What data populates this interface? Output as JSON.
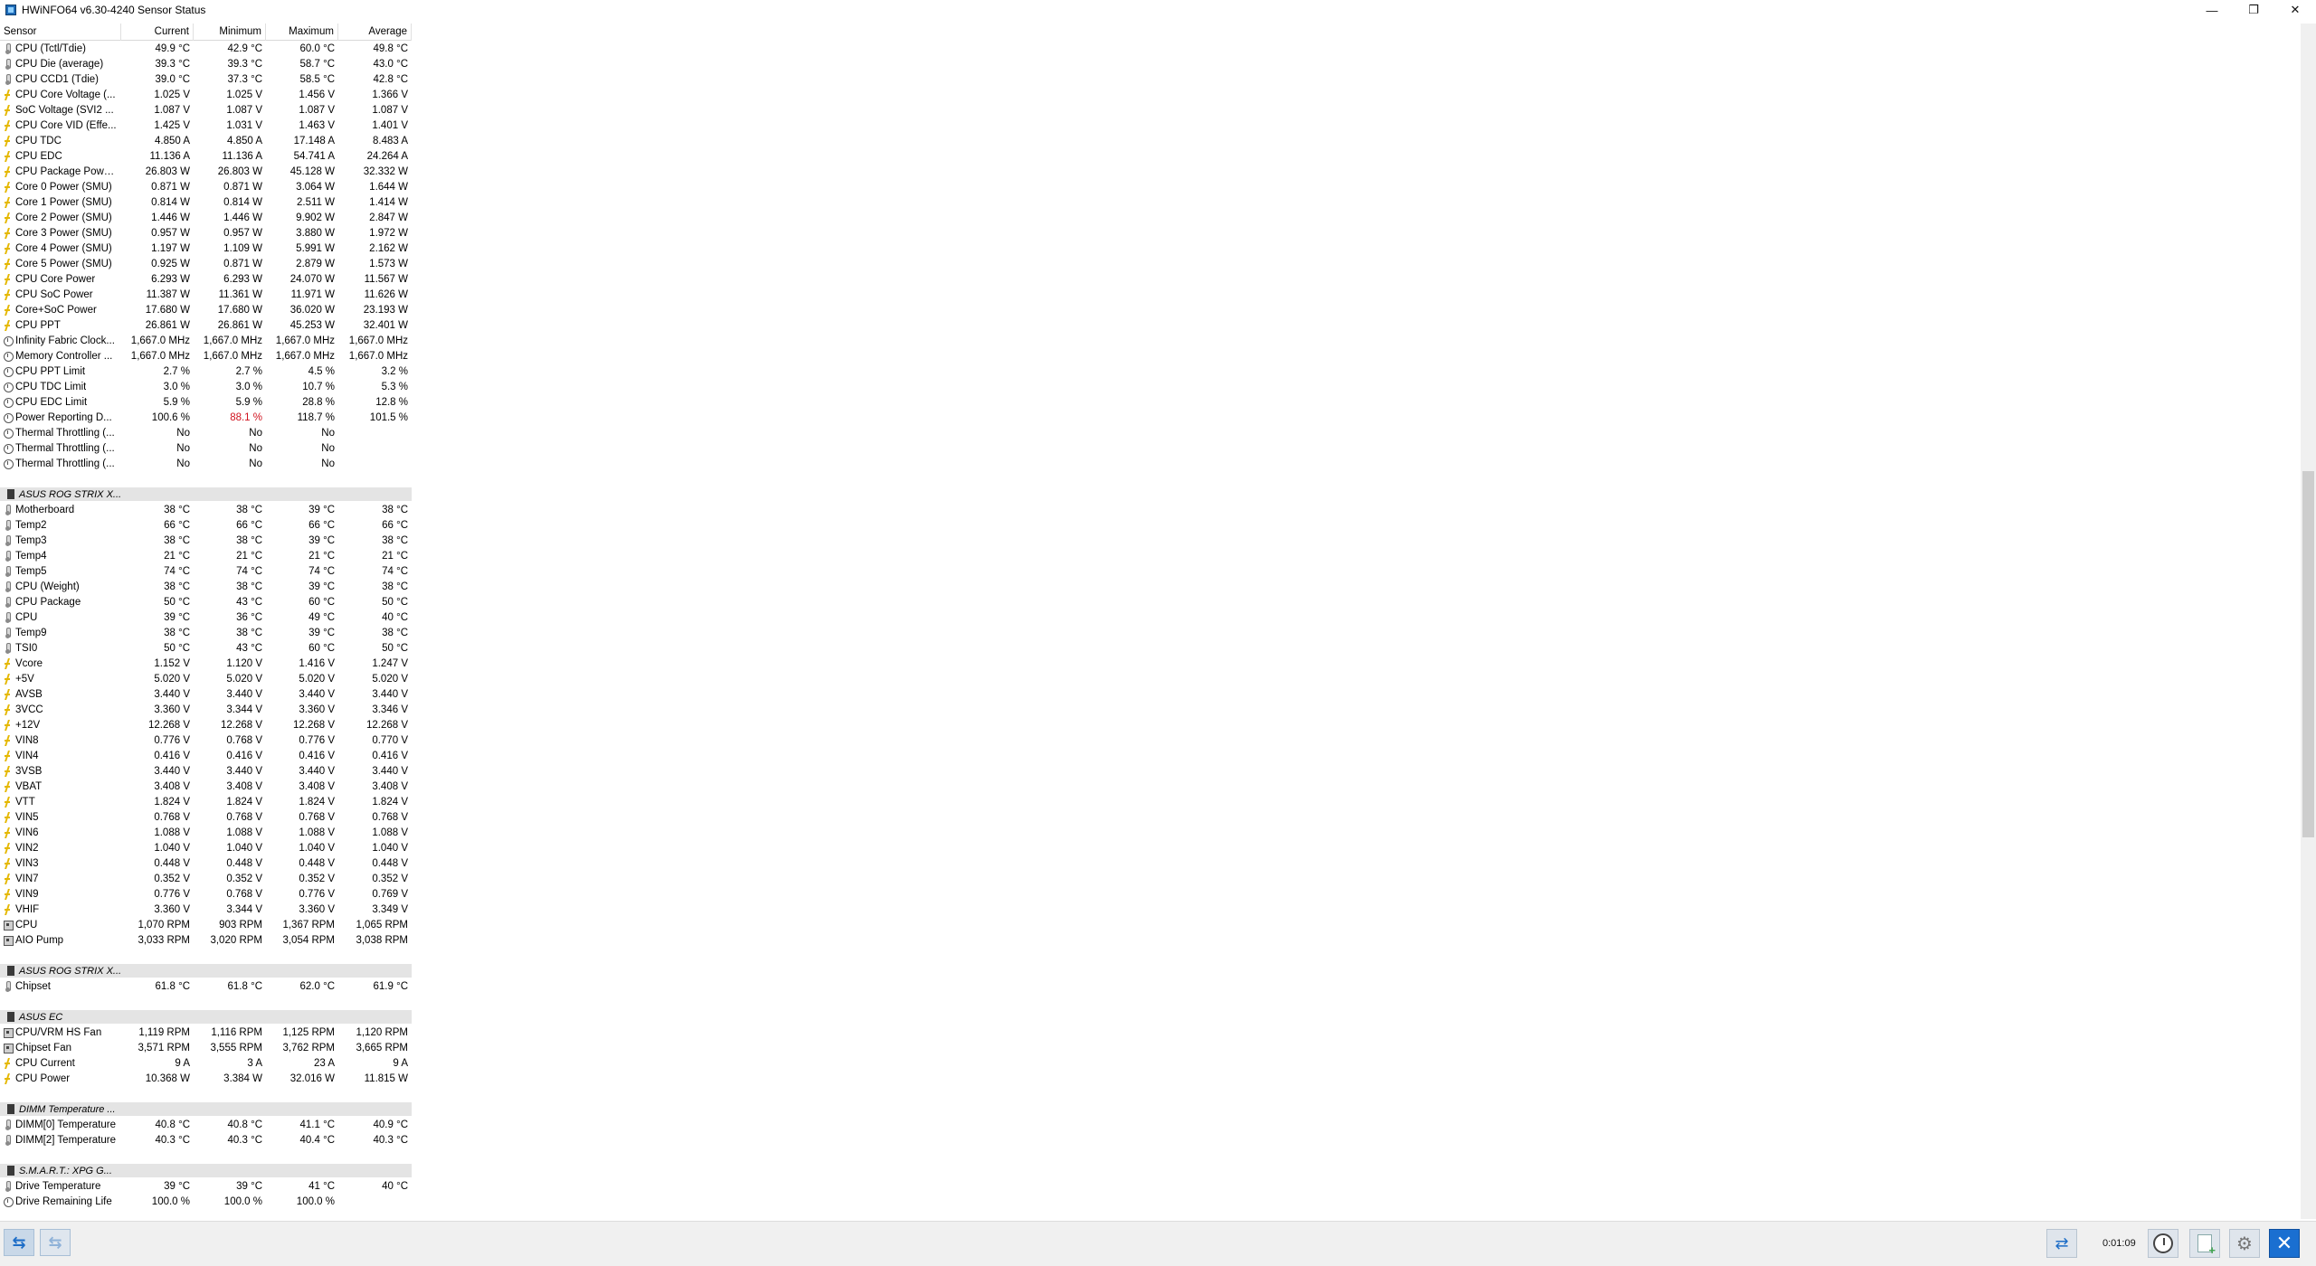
{
  "window": {
    "title": "HWiNFO64 v6.30-4240 Sensor Status",
    "controls": {
      "minimize": "—",
      "restore": "❐",
      "close": "✕"
    }
  },
  "columns": [
    "Sensor",
    "Current",
    "Minimum",
    "Maximum",
    "Average"
  ],
  "groups": [
    {
      "title": "",
      "rows": [
        {
          "icon": "therm",
          "name": "CPU (Tctl/Tdie)",
          "cur": "49.9 °C",
          "min": "42.9 °C",
          "max": "60.0 °C",
          "avg": "49.8 °C"
        },
        {
          "icon": "therm",
          "name": "CPU Die (average)",
          "cur": "39.3 °C",
          "min": "39.3 °C",
          "max": "58.7 °C",
          "avg": "43.0 °C"
        },
        {
          "icon": "therm",
          "name": "CPU CCD1 (Tdie)",
          "cur": "39.0 °C",
          "min": "37.3 °C",
          "max": "58.5 °C",
          "avg": "42.8 °C"
        },
        {
          "icon": "bolt",
          "name": "CPU Core Voltage (...",
          "cur": "1.025 V",
          "min": "1.025 V",
          "max": "1.456 V",
          "avg": "1.366 V"
        },
        {
          "icon": "bolt",
          "name": "SoC Voltage (SVI2 ...",
          "cur": "1.087 V",
          "min": "1.087 V",
          "max": "1.087 V",
          "avg": "1.087 V"
        },
        {
          "icon": "bolt",
          "name": "CPU Core VID (Effe...",
          "cur": "1.425 V",
          "min": "1.031 V",
          "max": "1.463 V",
          "avg": "1.401 V"
        },
        {
          "icon": "bolt",
          "name": "CPU TDC",
          "cur": "4.850 A",
          "min": "4.850 A",
          "max": "17.148 A",
          "avg": "8.483 A"
        },
        {
          "icon": "bolt",
          "name": "CPU EDC",
          "cur": "11.136 A",
          "min": "11.136 A",
          "max": "54.741 A",
          "avg": "24.264 A"
        },
        {
          "icon": "bolt",
          "name": "CPU Package Powe...",
          "cur": "26.803 W",
          "min": "26.803 W",
          "max": "45.128 W",
          "avg": "32.332 W"
        },
        {
          "icon": "bolt",
          "name": "Core 0 Power (SMU)",
          "cur": "0.871 W",
          "min": "0.871 W",
          "max": "3.064 W",
          "avg": "1.644 W"
        },
        {
          "icon": "bolt",
          "name": "Core 1 Power (SMU)",
          "cur": "0.814 W",
          "min": "0.814 W",
          "max": "2.511 W",
          "avg": "1.414 W"
        },
        {
          "icon": "bolt",
          "name": "Core 2 Power (SMU)",
          "cur": "1.446 W",
          "min": "1.446 W",
          "max": "9.902 W",
          "avg": "2.847 W"
        },
        {
          "icon": "bolt",
          "name": "Core 3 Power (SMU)",
          "cur": "0.957 W",
          "min": "0.957 W",
          "max": "3.880 W",
          "avg": "1.972 W"
        },
        {
          "icon": "bolt",
          "name": "Core 4 Power (SMU)",
          "cur": "1.197 W",
          "min": "1.109 W",
          "max": "5.991 W",
          "avg": "2.162 W"
        },
        {
          "icon": "bolt",
          "name": "Core 5 Power (SMU)",
          "cur": "0.925 W",
          "min": "0.871 W",
          "max": "2.879 W",
          "avg": "1.573 W"
        },
        {
          "icon": "bolt",
          "name": "CPU Core Power",
          "cur": "6.293 W",
          "min": "6.293 W",
          "max": "24.070 W",
          "avg": "11.567 W"
        },
        {
          "icon": "bolt",
          "name": "CPU SoC Power",
          "cur": "11.387 W",
          "min": "11.361 W",
          "max": "11.971 W",
          "avg": "11.626 W"
        },
        {
          "icon": "bolt",
          "name": "Core+SoC Power",
          "cur": "17.680 W",
          "min": "17.680 W",
          "max": "36.020 W",
          "avg": "23.193 W"
        },
        {
          "icon": "bolt",
          "name": "CPU PPT",
          "cur": "26.861 W",
          "min": "26.861 W",
          "max": "45.253 W",
          "avg": "32.401 W"
        },
        {
          "icon": "clock",
          "name": "Infinity Fabric Clock...",
          "cur": "1,667.0 MHz",
          "min": "1,667.0 MHz",
          "max": "1,667.0 MHz",
          "avg": "1,667.0 MHz"
        },
        {
          "icon": "clock",
          "name": "Memory Controller ...",
          "cur": "1,667.0 MHz",
          "min": "1,667.0 MHz",
          "max": "1,667.0 MHz",
          "avg": "1,667.0 MHz"
        },
        {
          "icon": "clock",
          "name": "CPU PPT Limit",
          "cur": "2.7 %",
          "min": "2.7 %",
          "max": "4.5 %",
          "avg": "3.2 %"
        },
        {
          "icon": "clock",
          "name": "CPU TDC Limit",
          "cur": "3.0 %",
          "min": "3.0 %",
          "max": "10.7 %",
          "avg": "5.3 %"
        },
        {
          "icon": "clock",
          "name": "CPU EDC Limit",
          "cur": "5.9 %",
          "min": "5.9 %",
          "max": "28.8 %",
          "avg": "12.8 %"
        },
        {
          "icon": "clock",
          "name": "Power Reporting D...",
          "cur": "100.6 %",
          "min": "88.1 %",
          "max": "118.7 %",
          "avg": "101.5 %",
          "min_red": true
        },
        {
          "icon": "clock",
          "name": "Thermal Throttling (...",
          "cur": "No",
          "min": "No",
          "max": "No",
          "avg": ""
        },
        {
          "icon": "clock",
          "name": "Thermal Throttling (...",
          "cur": "No",
          "min": "No",
          "max": "No",
          "avg": ""
        },
        {
          "icon": "clock",
          "name": "Thermal Throttling (...",
          "cur": "No",
          "min": "No",
          "max": "No",
          "avg": ""
        }
      ]
    },
    {
      "title": "ASUS ROG STRIX X...",
      "rows": [
        {
          "icon": "therm",
          "name": "Motherboard",
          "cur": "38 °C",
          "min": "38 °C",
          "max": "39 °C",
          "avg": "38 °C"
        },
        {
          "icon": "therm",
          "name": "Temp2",
          "cur": "66 °C",
          "min": "66 °C",
          "max": "66 °C",
          "avg": "66 °C"
        },
        {
          "icon": "therm",
          "name": "Temp3",
          "cur": "38 °C",
          "min": "38 °C",
          "max": "39 °C",
          "avg": "38 °C"
        },
        {
          "icon": "therm",
          "name": "Temp4",
          "cur": "21 °C",
          "min": "21 °C",
          "max": "21 °C",
          "avg": "21 °C"
        },
        {
          "icon": "therm",
          "name": "Temp5",
          "cur": "74 °C",
          "min": "74 °C",
          "max": "74 °C",
          "avg": "74 °C"
        },
        {
          "icon": "therm",
          "name": "CPU (Weight)",
          "cur": "38 °C",
          "min": "38 °C",
          "max": "39 °C",
          "avg": "38 °C"
        },
        {
          "icon": "therm",
          "name": "CPU Package",
          "cur": "50 °C",
          "min": "43 °C",
          "max": "60 °C",
          "avg": "50 °C"
        },
        {
          "icon": "therm",
          "name": "CPU",
          "cur": "39 °C",
          "min": "36 °C",
          "max": "49 °C",
          "avg": "40 °C"
        },
        {
          "icon": "therm",
          "name": "Temp9",
          "cur": "38 °C",
          "min": "38 °C",
          "max": "39 °C",
          "avg": "38 °C"
        },
        {
          "icon": "therm",
          "name": "TSI0",
          "cur": "50 °C",
          "min": "43 °C",
          "max": "60 °C",
          "avg": "50 °C"
        },
        {
          "icon": "bolt",
          "name": "Vcore",
          "cur": "1.152 V",
          "min": "1.120 V",
          "max": "1.416 V",
          "avg": "1.247 V"
        },
        {
          "icon": "bolt",
          "name": "+5V",
          "cur": "5.020 V",
          "min": "5.020 V",
          "max": "5.020 V",
          "avg": "5.020 V"
        },
        {
          "icon": "bolt",
          "name": "AVSB",
          "cur": "3.440 V",
          "min": "3.440 V",
          "max": "3.440 V",
          "avg": "3.440 V"
        },
        {
          "icon": "bolt",
          "name": "3VCC",
          "cur": "3.360 V",
          "min": "3.344 V",
          "max": "3.360 V",
          "avg": "3.346 V"
        },
        {
          "icon": "bolt",
          "name": "+12V",
          "cur": "12.268 V",
          "min": "12.268 V",
          "max": "12.268 V",
          "avg": "12.268 V"
        },
        {
          "icon": "bolt",
          "name": "VIN8",
          "cur": "0.776 V",
          "min": "0.768 V",
          "max": "0.776 V",
          "avg": "0.770 V"
        },
        {
          "icon": "bolt",
          "name": "VIN4",
          "cur": "0.416 V",
          "min": "0.416 V",
          "max": "0.416 V",
          "avg": "0.416 V"
        },
        {
          "icon": "bolt",
          "name": "3VSB",
          "cur": "3.440 V",
          "min": "3.440 V",
          "max": "3.440 V",
          "avg": "3.440 V"
        },
        {
          "icon": "bolt",
          "name": "VBAT",
          "cur": "3.408 V",
          "min": "3.408 V",
          "max": "3.408 V",
          "avg": "3.408 V"
        },
        {
          "icon": "bolt",
          "name": "VTT",
          "cur": "1.824 V",
          "min": "1.824 V",
          "max": "1.824 V",
          "avg": "1.824 V"
        },
        {
          "icon": "bolt",
          "name": "VIN5",
          "cur": "0.768 V",
          "min": "0.768 V",
          "max": "0.768 V",
          "avg": "0.768 V"
        },
        {
          "icon": "bolt",
          "name": "VIN6",
          "cur": "1.088 V",
          "min": "1.088 V",
          "max": "1.088 V",
          "avg": "1.088 V"
        },
        {
          "icon": "bolt",
          "name": "VIN2",
          "cur": "1.040 V",
          "min": "1.040 V",
          "max": "1.040 V",
          "avg": "1.040 V"
        },
        {
          "icon": "bolt",
          "name": "VIN3",
          "cur": "0.448 V",
          "min": "0.448 V",
          "max": "0.448 V",
          "avg": "0.448 V"
        },
        {
          "icon": "bolt",
          "name": "VIN7",
          "cur": "0.352 V",
          "min": "0.352 V",
          "max": "0.352 V",
          "avg": "0.352 V"
        },
        {
          "icon": "bolt",
          "name": "VIN9",
          "cur": "0.776 V",
          "min": "0.768 V",
          "max": "0.776 V",
          "avg": "0.769 V"
        },
        {
          "icon": "bolt",
          "name": "VHIF",
          "cur": "3.360 V",
          "min": "3.344 V",
          "max": "3.360 V",
          "avg": "3.349 V"
        },
        {
          "icon": "fan",
          "name": "CPU",
          "cur": "1,070 RPM",
          "min": "903 RPM",
          "max": "1,367 RPM",
          "avg": "1,065 RPM"
        },
        {
          "icon": "fan",
          "name": "AIO Pump",
          "cur": "3,033 RPM",
          "min": "3,020 RPM",
          "max": "3,054 RPM",
          "avg": "3,038 RPM"
        }
      ]
    },
    {
      "title": "ASUS ROG STRIX X...",
      "rows": [
        {
          "icon": "therm",
          "name": "Chipset",
          "cur": "61.8 °C",
          "min": "61.8 °C",
          "max": "62.0 °C",
          "avg": "61.9 °C"
        }
      ]
    },
    {
      "title": "ASUS EC",
      "rows": [
        {
          "icon": "fan",
          "name": "CPU/VRM HS Fan",
          "cur": "1,119 RPM",
          "min": "1,116 RPM",
          "max": "1,125 RPM",
          "avg": "1,120 RPM"
        },
        {
          "icon": "fan",
          "name": "Chipset Fan",
          "cur": "3,571 RPM",
          "min": "3,555 RPM",
          "max": "3,762 RPM",
          "avg": "3,665 RPM"
        },
        {
          "icon": "bolt",
          "name": "CPU Current",
          "cur": "9 A",
          "min": "3 A",
          "max": "23 A",
          "avg": "9 A"
        },
        {
          "icon": "bolt",
          "name": "CPU Power",
          "cur": "10.368 W",
          "min": "3.384 W",
          "max": "32.016 W",
          "avg": "11.815 W"
        }
      ]
    },
    {
      "title": "DIMM Temperature ...",
      "rows": [
        {
          "icon": "therm",
          "name": "DIMM[0] Temperature",
          "cur": "40.8 °C",
          "min": "40.8 °C",
          "max": "41.1 °C",
          "avg": "40.9 °C"
        },
        {
          "icon": "therm",
          "name": "DIMM[2] Temperature",
          "cur": "40.3 °C",
          "min": "40.3 °C",
          "max": "40.4 °C",
          "avg": "40.3 °C"
        }
      ]
    },
    {
      "title": "S.M.A.R.T.: XPG G...",
      "rows": [
        {
          "icon": "therm",
          "name": "Drive Temperature",
          "cur": "39 °C",
          "min": "39 °C",
          "max": "41 °C",
          "avg": "40 °C"
        },
        {
          "icon": "clock",
          "name": "Drive Remaining Life",
          "cur": "100.0 %",
          "min": "100.0 %",
          "max": "100.0 %",
          "avg": ""
        }
      ]
    }
  ],
  "bottombar": {
    "timer": "0:01:09",
    "nav_left": "⇆",
    "nav_right": "⇆",
    "sync": "⇄",
    "close": "✕",
    "gear": "⚙"
  },
  "colors": {
    "group_bar": "#e4e4e4",
    "alert_red": "#d0121e",
    "accent_blue": "#1d6dc7",
    "close_blue": "#1a6fd1"
  }
}
